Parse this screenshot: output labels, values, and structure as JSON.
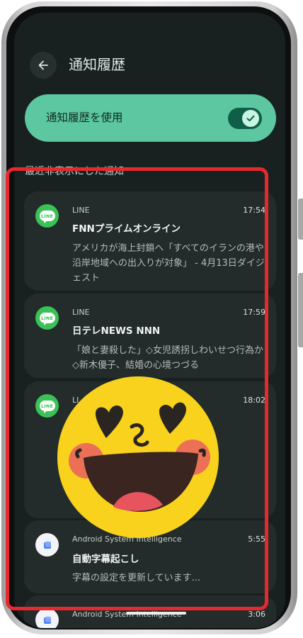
{
  "header": {
    "title": "通知履歴"
  },
  "toggle": {
    "label": "通知履歴を使用",
    "enabled": true
  },
  "section": {
    "title": "最近非表示にした通知"
  },
  "notifications": [
    {
      "app": "LINE",
      "time": "17:54",
      "title": "FNNプライムオンライン",
      "body": "アメリカが海上封鎖へ「すべてのイランの港や沿岸地域への出入りが対象」 - 4月13日ダイジェスト",
      "icon": "line-icon"
    },
    {
      "app": "LINE",
      "time": "17:59",
      "title": "日テレNEWS NNN",
      "body": "「娘と妻殺した」◇女児誘拐しわいせつ行為か◇新木優子、結婚の心境つづる",
      "icon": "line-icon"
    },
    {
      "app": "LI",
      "time": "18:02",
      "title": "",
      "body": "",
      "icon": "line-icon"
    },
    {
      "app": "Android System Intelligence",
      "time": "5:55",
      "title": "自動字幕起こし",
      "body": "字幕の設定を更新しています...",
      "icon": "android-system-intelligence-icon"
    },
    {
      "app": "Android System Intelligence",
      "time": "3:06",
      "title": "",
      "body": "",
      "icon": "android-system-intelligence-icon"
    }
  ],
  "line_icon_text": "LINE",
  "colors": {
    "accent": "#5cc7a0",
    "background": "#182120",
    "card": "#232c2b",
    "highlight": "#e8282f",
    "line_green": "#3ac257"
  }
}
